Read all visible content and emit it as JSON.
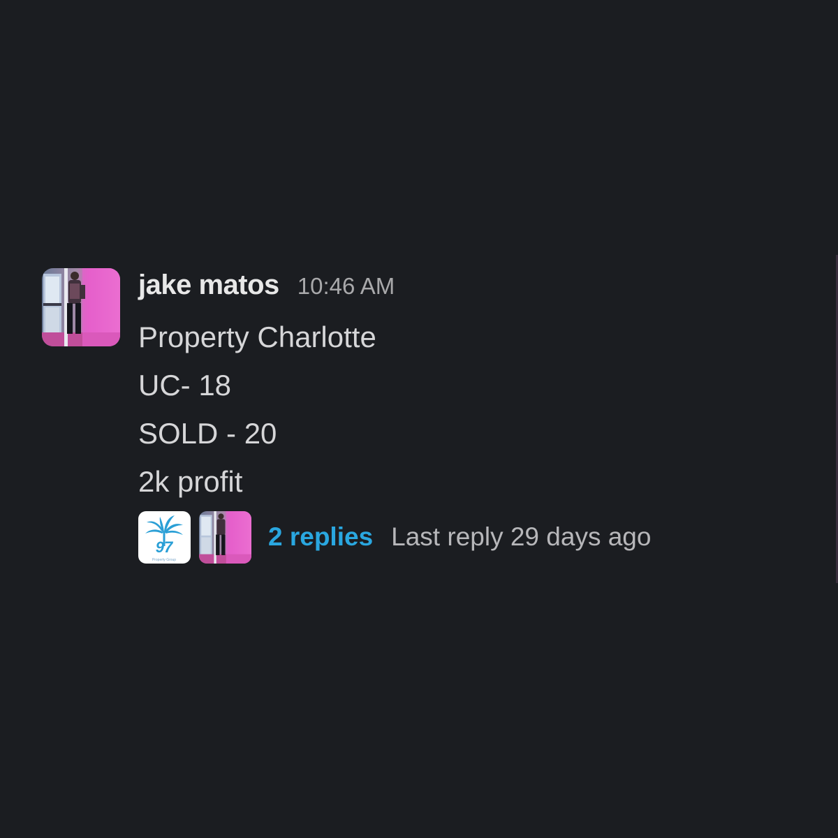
{
  "message": {
    "sender": "jake matos",
    "timestamp": "10:46 AM",
    "lines": [
      "Property Charlotte",
      "UC- 18",
      "SOLD - 20",
      "2k profit"
    ],
    "avatar": "user-photo-avatar"
  },
  "thread": {
    "participants": [
      {
        "avatar": "palm-tree-logo-avatar",
        "logo_text": "97",
        "logo_caption": "Property Group"
      },
      {
        "avatar": "user-photo-avatar"
      }
    ],
    "replies_label": "2 replies",
    "last_reply_label": "Last reply 29 days ago"
  },
  "colors": {
    "background": "#1b1d21",
    "sender": "#e8e8e8",
    "body_text": "#d6d6d8",
    "muted_text": "#a9a9ab",
    "link": "#2aa7e0"
  }
}
